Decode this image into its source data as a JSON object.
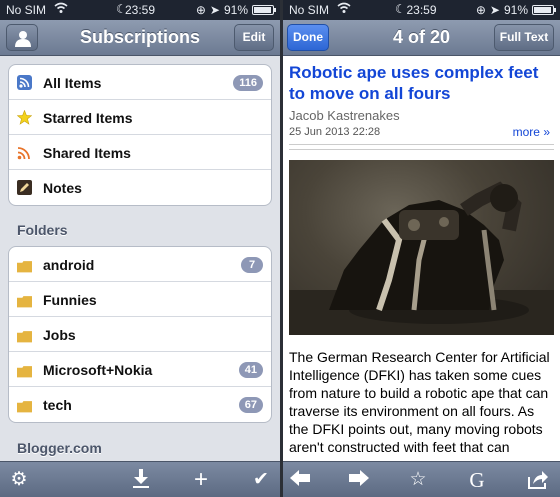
{
  "status_left": {
    "carrier": "No SIM",
    "time": "23:59",
    "battery": "91%"
  },
  "status_right": {
    "carrier": "No SIM",
    "time": "23:59",
    "battery": "91%"
  },
  "left_nav": {
    "title": "Subscriptions",
    "edit_label": "Edit"
  },
  "main_items": [
    {
      "label": "All Items",
      "badge": "116",
      "icon": "rss-feed-icon"
    },
    {
      "label": "Starred Items",
      "icon": "star-icon"
    },
    {
      "label": "Shared Items",
      "icon": "share-feed-icon"
    },
    {
      "label": "Notes",
      "icon": "note-icon"
    }
  ],
  "folders_header": "Folders",
  "folders": [
    {
      "label": "android",
      "badge": "7"
    },
    {
      "label": "Funnies"
    },
    {
      "label": "Jobs"
    },
    {
      "label": "Microsoft+Nokia",
      "badge": "41"
    },
    {
      "label": "tech",
      "badge": "67"
    }
  ],
  "next_section_header": "Blogger.com",
  "left_toolbar": [
    "gear-icon",
    "download-icon",
    "plus-icon",
    "checkmark-icon"
  ],
  "right_nav": {
    "done_label": "Done",
    "position": "4 of 20",
    "fulltext_label": "Full Text"
  },
  "article": {
    "title": "Robotic ape uses complex feet to move on all fours",
    "author": "Jacob Kastrenakes",
    "date": "25 Jun 2013 22:28",
    "more": "more »",
    "body": "The German Research Center for Artificial Intelligence (DFKI) has taken some cues from nature to build a robotic ape that can traverse its environment on all fours. As the DFKI points out, many moving robots aren't constructed with feet that can"
  },
  "right_toolbar": [
    "back-arrow-icon",
    "forward-arrow-icon",
    "star-outline-icon",
    "google-icon",
    "share-icon"
  ],
  "colors": {
    "link": "#1346d6",
    "badge": "#8e98b6",
    "navbar": "#7c8aa2"
  }
}
